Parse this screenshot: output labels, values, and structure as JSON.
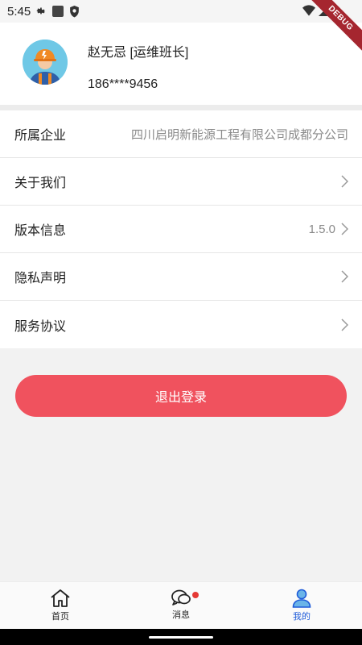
{
  "status_bar": {
    "time": "5:45",
    "icons": [
      "gear-icon",
      "square-icon",
      "shield-icon",
      "wifi-icon",
      "signal-icon"
    ]
  },
  "debug_banner": "DEBUG",
  "profile": {
    "name": "赵无忌 [运维班长]",
    "phone": "186****9456"
  },
  "menu": {
    "items": [
      {
        "label": "所属企业",
        "value": "四川启明新能源工程有限公司成都分公司",
        "chevron": false
      },
      {
        "label": "关于我们",
        "value": "",
        "chevron": true
      },
      {
        "label": "版本信息",
        "value": "1.5.0",
        "chevron": true
      },
      {
        "label": "隐私声明",
        "value": "",
        "chevron": true
      },
      {
        "label": "服务协议",
        "value": "",
        "chevron": true
      }
    ]
  },
  "logout": {
    "label": "退出登录"
  },
  "bottom_nav": {
    "items": [
      {
        "label": "首页",
        "icon": "home-icon",
        "active": false
      },
      {
        "label": "消息",
        "icon": "message-icon",
        "active": false,
        "badge": true
      },
      {
        "label": "我的",
        "icon": "user-icon",
        "active": true
      }
    ]
  },
  "colors": {
    "accent": "#f0525e",
    "active_nav": "#1e5bd9",
    "badge": "#e53935"
  }
}
